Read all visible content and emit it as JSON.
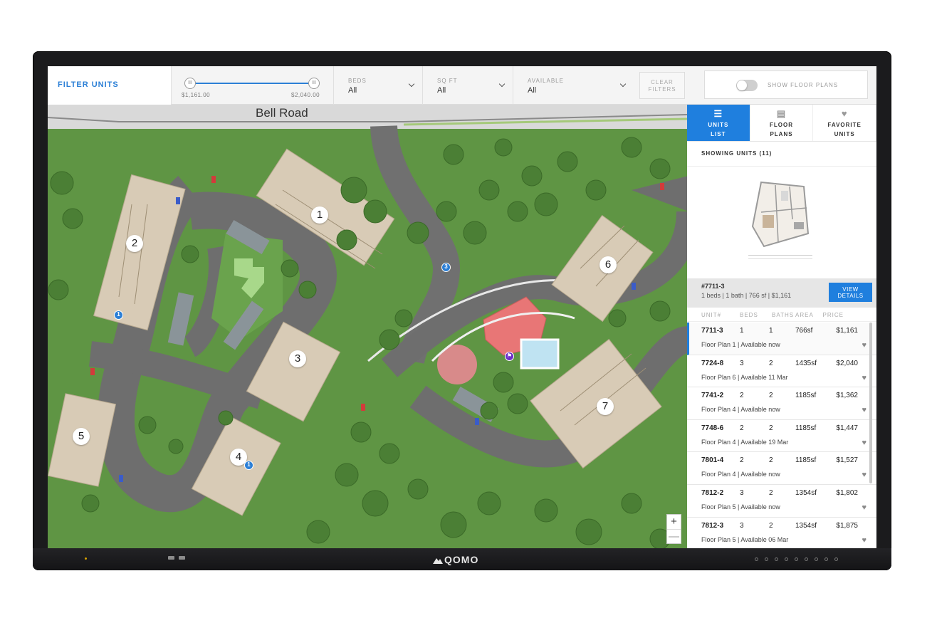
{
  "filter_bar": {
    "title": "FILTER UNITS",
    "price_min": "$1,161.00",
    "price_max": "$2,040.00",
    "beds_label": "BEDS",
    "beds_value": "All",
    "sqft_label": "SQ FT",
    "sqft_value": "All",
    "available_label": "AVAILABLE",
    "available_value": "All",
    "clear_line1": "CLEAR",
    "clear_line2": "FILTERS",
    "floor_plans_toggle": "SHOW FLOOR PLANS"
  },
  "map": {
    "road_label": "Bell Road",
    "buildings": [
      "1",
      "2",
      "3",
      "4",
      "5",
      "6",
      "7"
    ],
    "pins": [
      "1",
      "3",
      "1"
    ],
    "zoom_in": "+",
    "zoom_out": "—"
  },
  "sidebar": {
    "tabs": [
      {
        "line1": "UNITS",
        "line2": "LIST",
        "icon": "list-icon"
      },
      {
        "line1": "FLOOR",
        "line2": "PLANS",
        "icon": "floorplan-icon"
      },
      {
        "line1": "FAVORITE",
        "line2": "UNITS",
        "icon": "heart-icon"
      }
    ],
    "showing": "SHOWING UNITS (11)",
    "selected": {
      "unit": "#7711-3",
      "desc": "1 beds | 1 bath | 766 sf | $1,161",
      "view_line1": "VIEW",
      "view_line2": "DETAILS"
    },
    "columns": {
      "unit": "UNIT#",
      "beds": "BEDS",
      "baths": "BATHS",
      "area": "AREA",
      "price": "PRICE"
    },
    "units": [
      {
        "unit": "7711-3",
        "beds": "1",
        "baths": "1",
        "area": "766sf",
        "price": "$1,161",
        "sub": "Floor Plan 1 | Available now"
      },
      {
        "unit": "7724-8",
        "beds": "3",
        "baths": "2",
        "area": "1435sf",
        "price": "$2,040",
        "sub": "Floor Plan 6 | Available 11 Mar"
      },
      {
        "unit": "7741-2",
        "beds": "2",
        "baths": "2",
        "area": "1185sf",
        "price": "$1,362",
        "sub": "Floor Plan 4 | Available now"
      },
      {
        "unit": "7748-6",
        "beds": "2",
        "baths": "2",
        "area": "1185sf",
        "price": "$1,447",
        "sub": "Floor Plan 4 | Available 19 Mar"
      },
      {
        "unit": "7801-4",
        "beds": "2",
        "baths": "2",
        "area": "1185sf",
        "price": "$1,527",
        "sub": "Floor Plan 4 | Available now"
      },
      {
        "unit": "7812-2",
        "beds": "3",
        "baths": "2",
        "area": "1354sf",
        "price": "$1,802",
        "sub": "Floor Plan 5 | Available now"
      },
      {
        "unit": "7812-3",
        "beds": "3",
        "baths": "2",
        "area": "1354sf",
        "price": "$1,875",
        "sub": "Floor Plan 5 | Available 06 Mar"
      }
    ]
  },
  "device": {
    "brand": "QOMO"
  },
  "colors": {
    "accent": "#1f7fde",
    "grass": "#5f9544",
    "building": "#d8cbb6",
    "clubhouse": "#e87676"
  }
}
